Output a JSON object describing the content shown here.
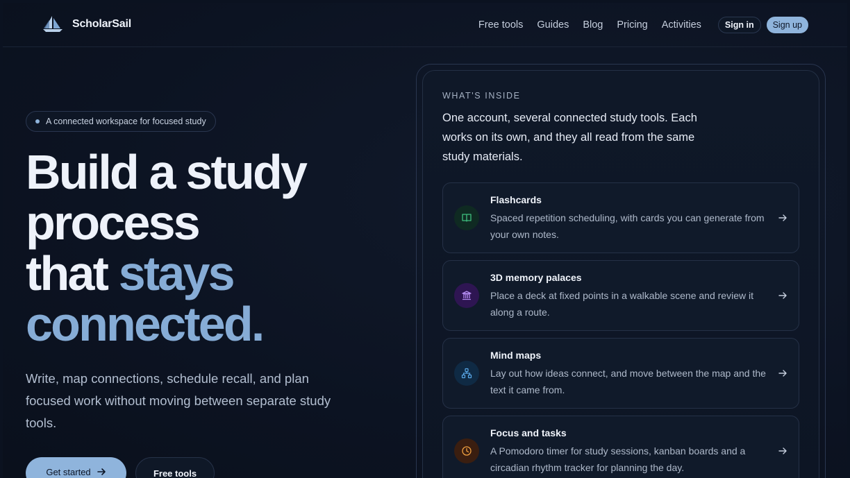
{
  "brand": {
    "name": "ScholarSail"
  },
  "nav": {
    "items": [
      "Free tools",
      "Guides",
      "Blog",
      "Pricing",
      "Activities"
    ],
    "sign_in": "Sign in",
    "sign_up": "Sign up"
  },
  "hero": {
    "pill": "A connected workspace for focused study",
    "headline_line1": "Build a study",
    "headline_line2": "process",
    "headline_line3a": "that ",
    "headline_line3b": "stays",
    "headline_line4": "connected.",
    "subtitle": "Write, map connections, schedule recall, and plan focused work without moving between separate study tools.",
    "cta_primary": "Get started",
    "cta_secondary": "Free tools"
  },
  "panel": {
    "eyebrow": "WHAT'S INSIDE",
    "lead": "One account, several connected study tools. Each works on its own, and they all read from the same study materials.",
    "cards": [
      {
        "title": "Flashcards",
        "desc": "Spaced repetition scheduling, with cards you can generate from your own notes.",
        "icon": "book-icon",
        "icon_color": "#3fbf7f",
        "icon_bg": "#0f2a22"
      },
      {
        "title": "3D memory palaces",
        "desc": "Place a deck at fixed points in a walkable scene and review it along a route.",
        "icon": "landmark-icon",
        "icon_color": "#b48cf2",
        "icon_bg": "#2e1552"
      },
      {
        "title": "Mind maps",
        "desc": "Lay out how ideas connect, and move between the map and the text it came from.",
        "icon": "network-icon",
        "icon_color": "#5aa8e8",
        "icon_bg": "#0f2a44"
      },
      {
        "title": "Focus and tasks",
        "desc": "A Pomodoro timer for study sessions, kanban boards and a circadian rhythm tracker for planning the day.",
        "icon": "clock-icon",
        "icon_color": "#f0a040",
        "icon_bg": "#3a1e10"
      }
    ]
  },
  "colors": {
    "accent": "#8fb4dc",
    "headline_accent": "#86acd6",
    "background": "#0b1220"
  }
}
